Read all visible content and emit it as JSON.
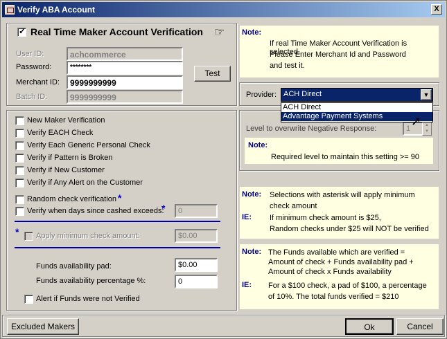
{
  "window": {
    "title": "Verify ABA Account",
    "close_label": "X"
  },
  "realtime": {
    "label": "Real Time Maker Account Verification",
    "checked": true,
    "user_id_label": "User ID:",
    "user_id_value": "achcommerce",
    "password_label": "Password:",
    "password_value": "********",
    "merchant_id_label": "Merchant ID:",
    "merchant_id_value": "9999999999",
    "batch_id_label": "Batch ID:",
    "batch_id_value": "9999999999",
    "test_button": "Test"
  },
  "note1": {
    "title": "Note:",
    "lines": [
      "If real Time Maker Account Verification is selected,",
      "Please Enter Merchant Id and Password",
      "and test it."
    ]
  },
  "provider": {
    "label": "Provider:",
    "selected": "ACH Direct",
    "options": [
      "ACH Direct",
      "Advantage Payment Systems"
    ],
    "level_label": "Level to overwrite Negative Response:",
    "level_value": "1",
    "note_title": "Note:",
    "note_text": "Required  level to maintain this setting >= 90"
  },
  "options": {
    "new_maker": "New Maker Verification",
    "verify_each": "Verify EACH Check",
    "verify_generic": "Verify Each Generic Personal Check",
    "verify_pattern": "Verify if Pattern is Broken",
    "verify_new_customer": "Verify if New Customer",
    "verify_alert": "Verify if Any Alert on the Customer",
    "random_check": "Random check verification",
    "verify_days": "Verify when days since cashed exceeds:",
    "days_value": "0",
    "apply_minimum": "Apply minimum check amount:",
    "minimum_value": "$0.00",
    "funds_pad_label": "Funds availability pad:",
    "funds_pad_value": "$0.00",
    "funds_pct_label": "Funds availability percentage %:",
    "funds_pct_value": "0",
    "alert_funds": "Alert if Funds were not Verified",
    "asterisk": "*"
  },
  "note2": {
    "note_title": "Note:",
    "note_lines": [
      "Selections with asterisk will apply minimum",
      "check amount"
    ],
    "ie_title": "IE:",
    "ie_lines": [
      "If minimum check amount is $25,",
      "Random checks under $25 will NOT be verified"
    ]
  },
  "note3": {
    "note_title": "Note:",
    "note_lines": [
      "The Funds available which are  verified =",
      "Amount of check + Funds availability pad +",
      "Amount of check x Funds availability"
    ],
    "ie_title": "IE:",
    "ie_lines": [
      "For a $100 check, a pad of $100, a percentage",
      "of 10%. The total funds verified = $210"
    ]
  },
  "footer": {
    "excluded": "Excluded Makers",
    "ok": "Ok",
    "cancel": "Cancel"
  }
}
